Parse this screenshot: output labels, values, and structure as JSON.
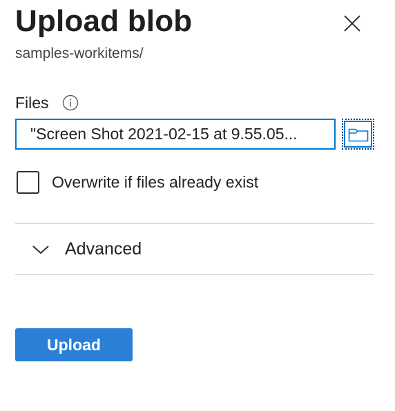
{
  "panel": {
    "title": "Upload blob",
    "subtitle": "samples-workitems/"
  },
  "files": {
    "label": "Files",
    "value": "\"Screen Shot 2021-02-15 at 9.55.05...",
    "info_icon": "info-icon",
    "browse_icon": "folder-icon"
  },
  "overwrite": {
    "label": "Overwrite if files already exist",
    "checked": false
  },
  "advanced": {
    "label": "Advanced",
    "expanded": false
  },
  "actions": {
    "upload_label": "Upload"
  },
  "colors": {
    "accent": "#0078d4",
    "upload_button": "#2b7fd6",
    "divider": "#c8c6c4"
  }
}
